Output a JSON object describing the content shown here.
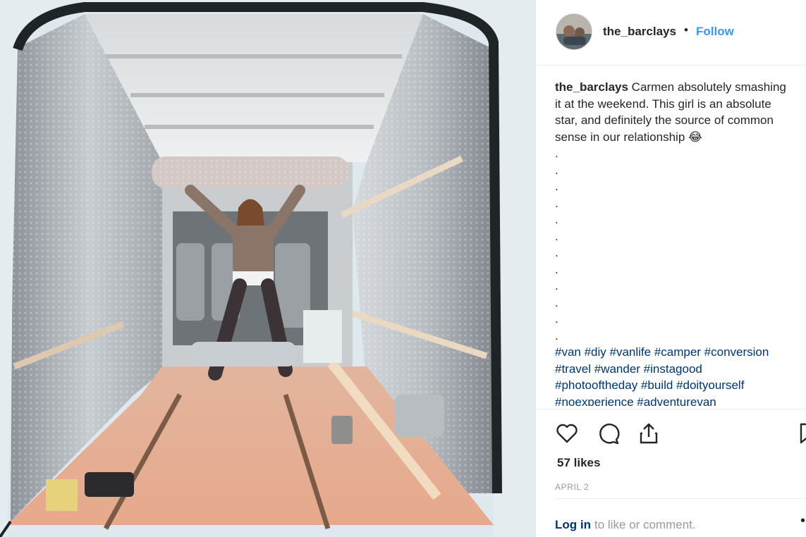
{
  "post": {
    "username": "the_barclays",
    "separator": "•",
    "follow_label": "Follow",
    "caption": {
      "username": "the_barclays",
      "line1": " Carmen absolutely smashing",
      "line2": "it at the weekend. This girl is an absolute",
      "line3": "star, and definitely the source of common",
      "line4": "sense in our relationship 😂",
      "dots": [
        ".",
        ".",
        ".",
        ".",
        ".",
        ".",
        ".",
        ".",
        ".",
        ".",
        ".",
        "."
      ],
      "hashtag_lines": [
        "#van #diy #vanlife #camper #conversion",
        "#travel #wander #instagood",
        "#photooftheday #build #doityourself",
        "#noexperience #adventurevan"
      ]
    },
    "likes": "57 likes",
    "date": "APRIL 2",
    "login_label": "Log in",
    "login_suffix": "to like or comment.",
    "more_dot": "•"
  },
  "icons": {
    "like": "heart-icon",
    "comment": "comment-icon",
    "share": "share-icon",
    "save": "bookmark-icon"
  },
  "colors": {
    "link": "#3897f0",
    "hashtag": "#003569",
    "muted": "#999999"
  }
}
